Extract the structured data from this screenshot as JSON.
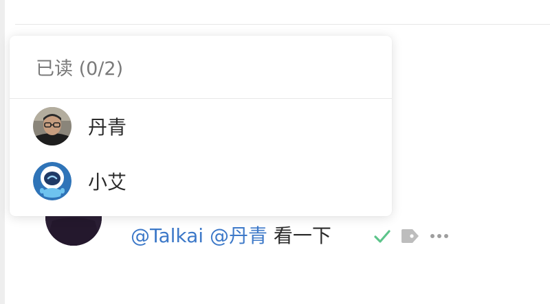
{
  "popover": {
    "title": "已读 (0/2)",
    "readers": [
      {
        "name": "丹青",
        "avatar_icon": "person-photo-avatar"
      },
      {
        "name": "小艾",
        "avatar_icon": "robot-avatar"
      }
    ]
  },
  "message": {
    "mentions": [
      "@Talkai",
      "@丹青"
    ],
    "text": "看一下",
    "actions": [
      {
        "icon": "check-icon",
        "color": "#5cc48a"
      },
      {
        "icon": "tag-icon",
        "color": "#bdbdbd"
      },
      {
        "icon": "more-icon",
        "color": "#9e9e9e"
      }
    ]
  },
  "colors": {
    "mention": "#3c78c8",
    "muted_text": "#7a7a7a",
    "text": "#2b2b2b"
  }
}
